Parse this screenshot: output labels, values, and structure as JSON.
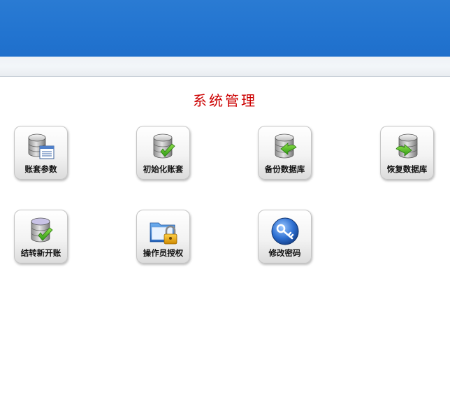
{
  "page": {
    "title": "系统管理"
  },
  "tiles": [
    {
      "label": "账套参数",
      "icon": "database-settings-icon"
    },
    {
      "label": "初始化账套",
      "icon": "database-check-icon"
    },
    {
      "label": "备份数据库",
      "icon": "database-backup-icon"
    },
    {
      "label": "恢复数据库",
      "icon": "database-restore-icon"
    },
    {
      "label": "结转新开账",
      "icon": "database-carryover-icon"
    },
    {
      "label": "操作员授权",
      "icon": "folder-lock-icon"
    },
    {
      "label": "修改密码",
      "icon": "key-icon"
    }
  ],
  "colors": {
    "header": "#2274d0",
    "title": "#cc0000"
  }
}
